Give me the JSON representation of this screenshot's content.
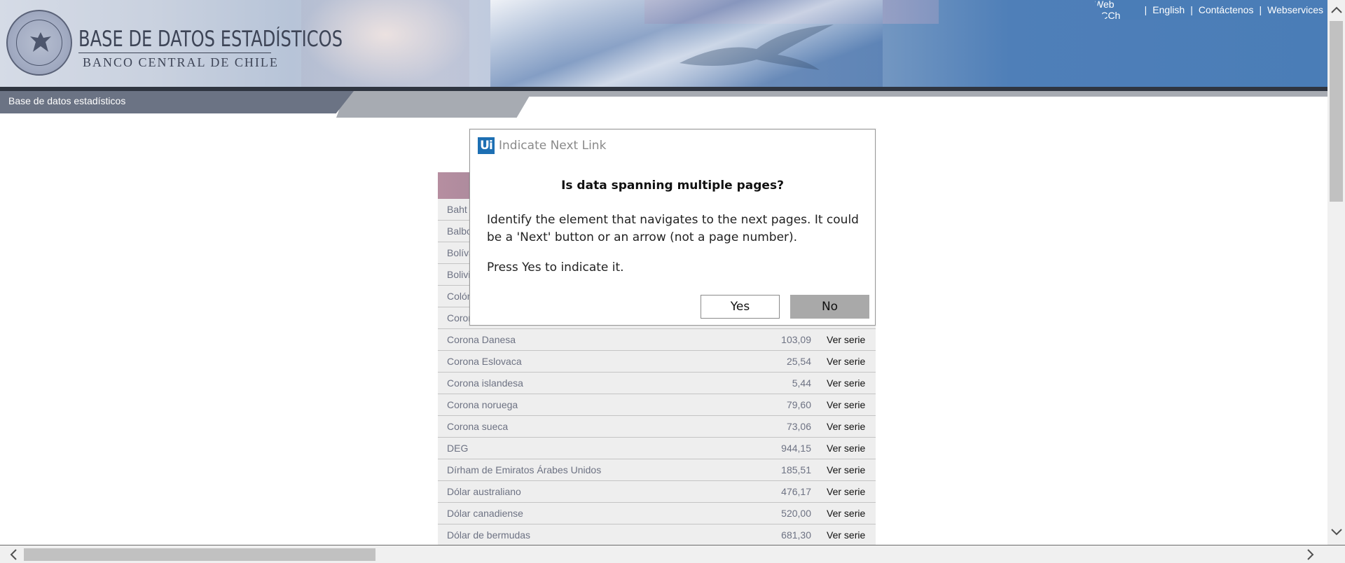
{
  "header": {
    "title": "BASE DE DATOS ESTADÍSTICOS",
    "subtitle": "BANCO CENTRAL DE CHILE",
    "links": [
      "Web BCCh",
      "English",
      "Contáctenos",
      "Webservices"
    ],
    "separator": "|"
  },
  "breadcrumb": "Base de datos estadísticos",
  "table": {
    "link_label": "Ver serie",
    "hidden_rows": [
      "Baht",
      "Balbo",
      "Bolíva",
      "Bolivi",
      "Colón",
      "Coron"
    ],
    "rows": [
      {
        "name": "Corona Danesa",
        "value": "103,09"
      },
      {
        "name": "Corona Eslovaca",
        "value": "25,54"
      },
      {
        "name": "Corona islandesa",
        "value": "5,44"
      },
      {
        "name": "Corona noruega",
        "value": "79,60"
      },
      {
        "name": "Corona sueca",
        "value": "73,06"
      },
      {
        "name": "DEG",
        "value": "944,15"
      },
      {
        "name": "Dírham de Emiratos Árabes Unidos",
        "value": "185,51"
      },
      {
        "name": "Dólar australiano",
        "value": "476,17"
      },
      {
        "name": "Dólar canadiense",
        "value": "520,00"
      },
      {
        "name": "Dólar de bermudas",
        "value": "681,30"
      }
    ]
  },
  "dialog": {
    "logo": "Ui",
    "title": "Indicate Next Link",
    "heading": "Is data spanning multiple pages?",
    "body": "Identify the element that navigates to the next pages. It could be a 'Next' button or an arrow (not a page number).",
    "instruction": "Press Yes to indicate it.",
    "yes_label": "Yes",
    "no_label": "No"
  },
  "colors": {
    "banner_blue": "#4a7db7",
    "nav_dark": "#6b7384",
    "uipath_blue": "#1d6fb3",
    "no_button": "#a9a9a9"
  }
}
